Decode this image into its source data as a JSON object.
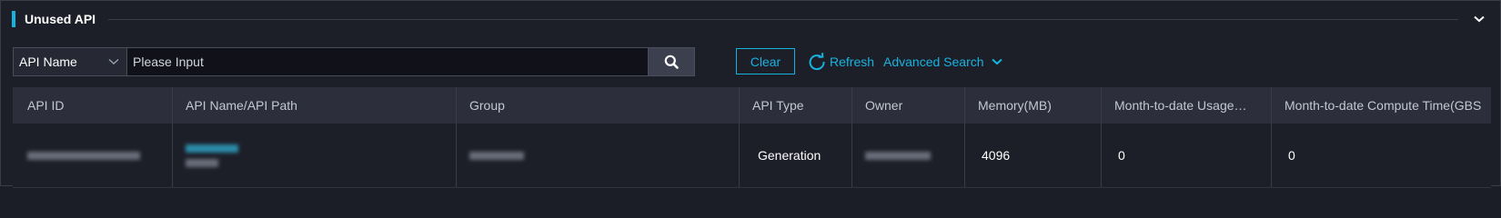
{
  "header": {
    "title": "Unused API"
  },
  "search": {
    "field_select": "API Name",
    "placeholder": "Please Input",
    "value": ""
  },
  "actions": {
    "clear_label": "Clear",
    "refresh_label": "Refresh",
    "advanced_search_label": "Advanced Search"
  },
  "table": {
    "columns": [
      "API ID",
      "API Name/API Path",
      "Group",
      "API Type",
      "Owner",
      "Memory(MB)",
      "Month-to-date Usage…",
      "Month-to-date Compute Time(GBS"
    ],
    "rows": [
      {
        "api_type": "Generation",
        "memory": "4096",
        "usage": "0",
        "compute_time": "0"
      }
    ]
  },
  "colors": {
    "accent": "#17b3e0",
    "background": "#1d1f28",
    "header_row": "#2c2f3b"
  },
  "icons": [
    "chevron-down-icon",
    "search-icon",
    "refresh-icon"
  ]
}
